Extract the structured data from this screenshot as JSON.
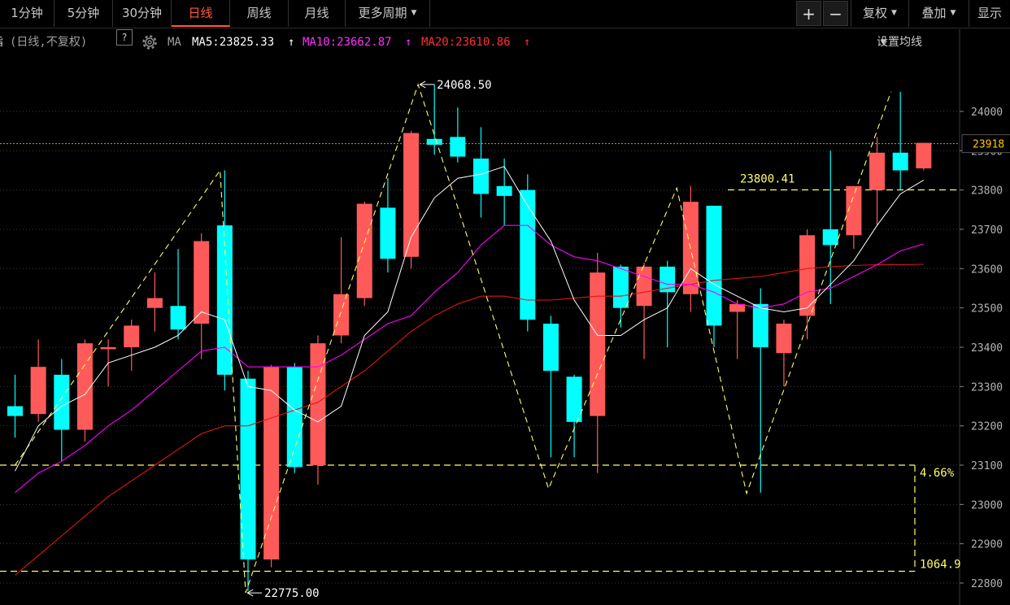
{
  "toolbar": {
    "periods": [
      "1分钟",
      "5分钟",
      "30分钟",
      "日线",
      "周线",
      "月线",
      "更多周期"
    ],
    "active_period": "日线",
    "plus": "+",
    "minus": "−",
    "fuquan": "复权",
    "diejia": "叠加",
    "xianshi": "显示"
  },
  "ma_bar": {
    "title_fragment": "指数",
    "mode": "(日线,不复权)",
    "help": "?",
    "ma_label": "MA",
    "ma5": "MA5:23825.33",
    "ma10": "MA10:23662.87",
    "ma20": "MA20:23610.86",
    "arrow": "↑",
    "settings": "设置均线"
  },
  "colors": {
    "up": "#ff5a5a",
    "down": "#00ffff",
    "ma5": "#ffffff",
    "ma10": "#ff00ff",
    "ma20": "#e01515",
    "zigzag": "#ffff66",
    "grid": "#3c3c3c",
    "current_price": "#ffc800"
  },
  "annotations": {
    "high": "24068.50",
    "low": "22775.00",
    "level": "23800.41",
    "pct": "4.66%",
    "range": "1064.9",
    "current": "23918"
  },
  "chart_data": {
    "type": "candlestick",
    "ylim": [
      22750,
      24150
    ],
    "y_ticks": [
      22800,
      22900,
      23000,
      23100,
      23200,
      23300,
      23400,
      23500,
      23600,
      23700,
      23800,
      23900,
      24000
    ],
    "current_price": 23918,
    "candles": [
      {
        "o": 23250,
        "c": 23225,
        "h": 23330,
        "l": 23170
      },
      {
        "o": 23230,
        "c": 23350,
        "h": 23420,
        "l": 23210
      },
      {
        "o": 23330,
        "c": 23190,
        "h": 23370,
        "l": 23110
      },
      {
        "o": 23190,
        "c": 23410,
        "h": 23420,
        "l": 23160
      },
      {
        "o": 23395,
        "c": 23400,
        "h": 23420,
        "l": 23300
      },
      {
        "o": 23400,
        "c": 23455,
        "h": 23470,
        "l": 23340
      },
      {
        "o": 23500,
        "c": 23525,
        "h": 23590,
        "l": 23440
      },
      {
        "o": 23505,
        "c": 23445,
        "h": 23650,
        "l": 23420
      },
      {
        "o": 23460,
        "c": 23670,
        "h": 23690,
        "l": 23370
      },
      {
        "o": 23710,
        "c": 23330,
        "h": 23850,
        "l": 23290
      },
      {
        "o": 23320,
        "c": 22860,
        "h": 23340,
        "l": 22780
      },
      {
        "o": 22860,
        "c": 23350,
        "h": 23355,
        "l": 22840
      },
      {
        "o": 23350,
        "c": 23095,
        "h": 23360,
        "l": 23080
      },
      {
        "o": 23100,
        "c": 23410,
        "h": 23430,
        "l": 23050
      },
      {
        "o": 23430,
        "c": 23535,
        "h": 23680,
        "l": 23410
      },
      {
        "o": 23525,
        "c": 23765,
        "h": 23770,
        "l": 23505
      },
      {
        "o": 23755,
        "c": 23625,
        "h": 23830,
        "l": 23590
      },
      {
        "o": 23630,
        "c": 23945,
        "h": 23950,
        "l": 23600
      },
      {
        "o": 23930,
        "c": 23915,
        "h": 24068.5,
        "l": 23890
      },
      {
        "o": 23935,
        "c": 23885,
        "h": 24010,
        "l": 23870
      },
      {
        "o": 23880,
        "c": 23790,
        "h": 23960,
        "l": 23730
      },
      {
        "o": 23810,
        "c": 23785,
        "h": 23880,
        "l": 23710
      },
      {
        "o": 23800,
        "c": 23470,
        "h": 23840,
        "l": 23440
      },
      {
        "o": 23460,
        "c": 23340,
        "h": 23480,
        "l": 23120
      },
      {
        "o": 23325,
        "c": 23210,
        "h": 23330,
        "l": 23120
      },
      {
        "o": 23225,
        "c": 23590,
        "h": 23640,
        "l": 23080
      },
      {
        "o": 23605,
        "c": 23500,
        "h": 23610,
        "l": 23450
      },
      {
        "o": 23505,
        "c": 23605,
        "h": 23615,
        "l": 23370
      },
      {
        "o": 23605,
        "c": 23540,
        "h": 23620,
        "l": 23400
      },
      {
        "o": 23535,
        "c": 23770,
        "h": 23810,
        "l": 23490
      },
      {
        "o": 23760,
        "c": 23455,
        "h": 23760,
        "l": 23400
      },
      {
        "o": 23490,
        "c": 23510,
        "h": 23520,
        "l": 23370
      },
      {
        "o": 23510,
        "c": 23400,
        "h": 23550,
        "l": 23030
      },
      {
        "o": 23385,
        "c": 23460,
        "h": 23470,
        "l": 23300
      },
      {
        "o": 23480,
        "c": 23685,
        "h": 23700,
        "l": 23420
      },
      {
        "o": 23700,
        "c": 23660,
        "h": 23900,
        "l": 23510
      },
      {
        "o": 23685,
        "c": 23810,
        "h": 23810,
        "l": 23650
      },
      {
        "o": 23800,
        "c": 23895,
        "h": 23935,
        "l": 23710
      },
      {
        "o": 23895,
        "c": 23850,
        "h": 24050,
        "l": 23800
      },
      {
        "o": 23855,
        "c": 23920,
        "h": 23920,
        "l": 23850
      }
    ],
    "ma5": [
      23085,
      23200,
      23250,
      23280,
      23360,
      23380,
      23400,
      23430,
      23490,
      23470,
      23300,
      23290,
      23240,
      23210,
      23250,
      23430,
      23490,
      23680,
      23780,
      23830,
      23840,
      23860,
      23760,
      23670,
      23520,
      23430,
      23430,
      23470,
      23500,
      23600,
      23560,
      23530,
      23500,
      23490,
      23500,
      23560,
      23620,
      23710,
      23790,
      23825
    ],
    "ma10": [
      23030,
      23080,
      23110,
      23150,
      23200,
      23240,
      23290,
      23340,
      23390,
      23400,
      23350,
      23350,
      23350,
      23350,
      23380,
      23420,
      23460,
      23480,
      23540,
      23590,
      23660,
      23710,
      23710,
      23660,
      23630,
      23620,
      23600,
      23580,
      23560,
      23560,
      23540,
      23510,
      23500,
      23510,
      23540,
      23550,
      23580,
      23610,
      23645,
      23663
    ],
    "ma20": [
      22820,
      22870,
      22920,
      22970,
      23020,
      23060,
      23100,
      23140,
      23180,
      23200,
      23200,
      23220,
      23240,
      23260,
      23300,
      23340,
      23390,
      23440,
      23480,
      23510,
      23530,
      23530,
      23520,
      23520,
      23525,
      23530,
      23530,
      23540,
      23550,
      23560,
      23570,
      23575,
      23580,
      23590,
      23600,
      23605,
      23608,
      23610,
      23610,
      23611
    ],
    "zigzag": [
      {
        "i": 0,
        "v": 23100
      },
      {
        "i": 8.8,
        "v": 23850
      },
      {
        "i": 9.9,
        "v": 22775
      },
      {
        "i": 17.3,
        "v": 24068.5
      },
      {
        "i": 22.9,
        "v": 23040
      },
      {
        "i": 28.4,
        "v": 23805
      },
      {
        "i": 31.4,
        "v": 23028
      },
      {
        "i": 37.6,
        "v": 24050
      }
    ]
  }
}
